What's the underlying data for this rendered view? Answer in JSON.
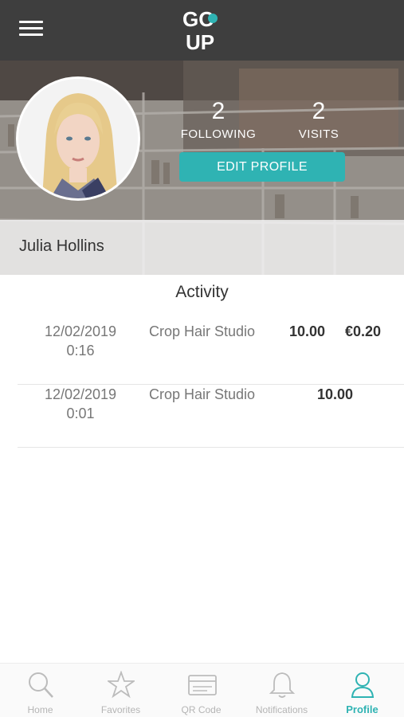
{
  "app": {
    "logo_text_top": "GO",
    "logo_text_bottom": "UP"
  },
  "profile": {
    "name": "Julia Hollins",
    "following_count": "2",
    "following_label": "FOLLOWING",
    "visits_count": "2",
    "visits_label": "VISITS",
    "edit_label": "EDIT PROFILE"
  },
  "activity": {
    "title": "Activity",
    "rows": [
      {
        "date": "12/02/2019",
        "time": "0:16",
        "place": "Crop Hair Studio",
        "amount": "10.00",
        "reward": "€0.20"
      },
      {
        "date": "12/02/2019",
        "time": "0:01",
        "place": "Crop Hair Studio",
        "amount": "10.00",
        "reward": ""
      }
    ]
  },
  "nav": {
    "home": "Home",
    "favorites": "Favorites",
    "qr": "QR Code",
    "notifications": "Notifications",
    "profile": "Profile"
  },
  "colors": {
    "accent": "#2fb3b3",
    "topbar": "#3e3e3e"
  }
}
